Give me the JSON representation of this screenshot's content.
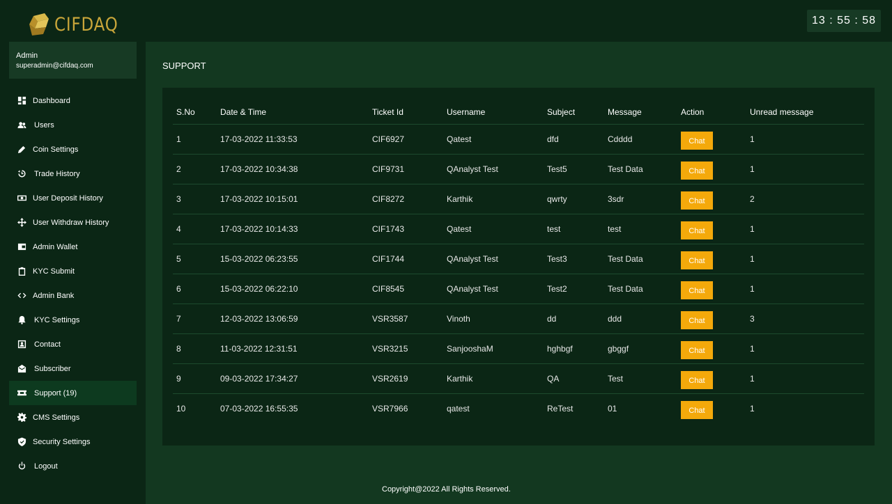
{
  "brand": {
    "name": "CIFDAQ"
  },
  "clock": {
    "time": "13 : 55 : 58"
  },
  "admin": {
    "name": "Admin",
    "email": "superadmin@cifdaq.com"
  },
  "sidebar": {
    "items": [
      {
        "label": "Dashboard",
        "icon": "dashboard-icon"
      },
      {
        "label": "Users",
        "icon": "users-icon"
      },
      {
        "label": "Coin Settings",
        "icon": "pencil-icon"
      },
      {
        "label": "Trade History",
        "icon": "history-icon"
      },
      {
        "label": "User Deposit History",
        "icon": "money-icon"
      },
      {
        "label": "User Withdraw History",
        "icon": "arrows-icon"
      },
      {
        "label": "Admin Wallet",
        "icon": "wallet-icon"
      },
      {
        "label": "KYC Submit",
        "icon": "clipboard-icon"
      },
      {
        "label": "Admin Bank",
        "icon": "code-icon"
      },
      {
        "label": "KYC Settings",
        "icon": "bell-icon"
      },
      {
        "label": "Contact",
        "icon": "contact-icon"
      },
      {
        "label": "Subscriber",
        "icon": "envelope-icon"
      },
      {
        "label": "Support (19)",
        "icon": "ticket-icon",
        "active": true
      },
      {
        "label": "CMS Settings",
        "icon": "gear-icon"
      },
      {
        "label": "Security Settings",
        "icon": "shield-icon"
      },
      {
        "label": "Logout",
        "icon": "power-icon"
      }
    ]
  },
  "main": {
    "title": "SUPPORT",
    "table": {
      "headers": [
        "S.No",
        "Date & Time",
        "Ticket Id",
        "Username",
        "Subject",
        "Message",
        "Action",
        "Unread message"
      ],
      "action_label": "Chat",
      "rows": [
        [
          "1",
          "17-03-2022 11:33:53",
          "CIF6927",
          "Qatest",
          "dfd",
          "Cdddd",
          "1"
        ],
        [
          "2",
          "17-03-2022 10:34:38",
          "CIF9731",
          "QAnalyst Test",
          "Test5",
          "Test Data",
          "1"
        ],
        [
          "3",
          "17-03-2022 10:15:01",
          "CIF8272",
          "Karthik",
          "qwrty",
          "3sdr",
          "2"
        ],
        [
          "4",
          "17-03-2022 10:14:33",
          "CIF1743",
          "Qatest",
          "test",
          "test",
          "1"
        ],
        [
          "5",
          "15-03-2022 06:23:55",
          "CIF1744",
          "QAnalyst Test",
          "Test3",
          "Test Data",
          "1"
        ],
        [
          "6",
          "15-03-2022 06:22:10",
          "CIF8545",
          "QAnalyst Test",
          "Test2",
          "Test Data",
          "1"
        ],
        [
          "7",
          "12-03-2022 13:06:59",
          "VSR3587",
          "Vinoth",
          "dd",
          "ddd",
          "3"
        ],
        [
          "8",
          "11-03-2022 12:31:51",
          "VSR3215",
          "SanjooshaM",
          "hghbgf",
          "gbggf",
          "1"
        ],
        [
          "9",
          "09-03-2022 17:34:27",
          "VSR2619",
          "Karthik",
          "QA",
          "Test",
          "1"
        ],
        [
          "10",
          "07-03-2022 16:55:35",
          "VSR7966",
          "qatest",
          "ReTest",
          "01",
          "1"
        ]
      ]
    }
  },
  "footer": {
    "text": "Copyright@2022 All Rights Reserved."
  },
  "colors": {
    "accent": "#f4a90b",
    "brand_gold": "#c9a63a",
    "background": "#133820",
    "sidebar": "#0b2615"
  }
}
